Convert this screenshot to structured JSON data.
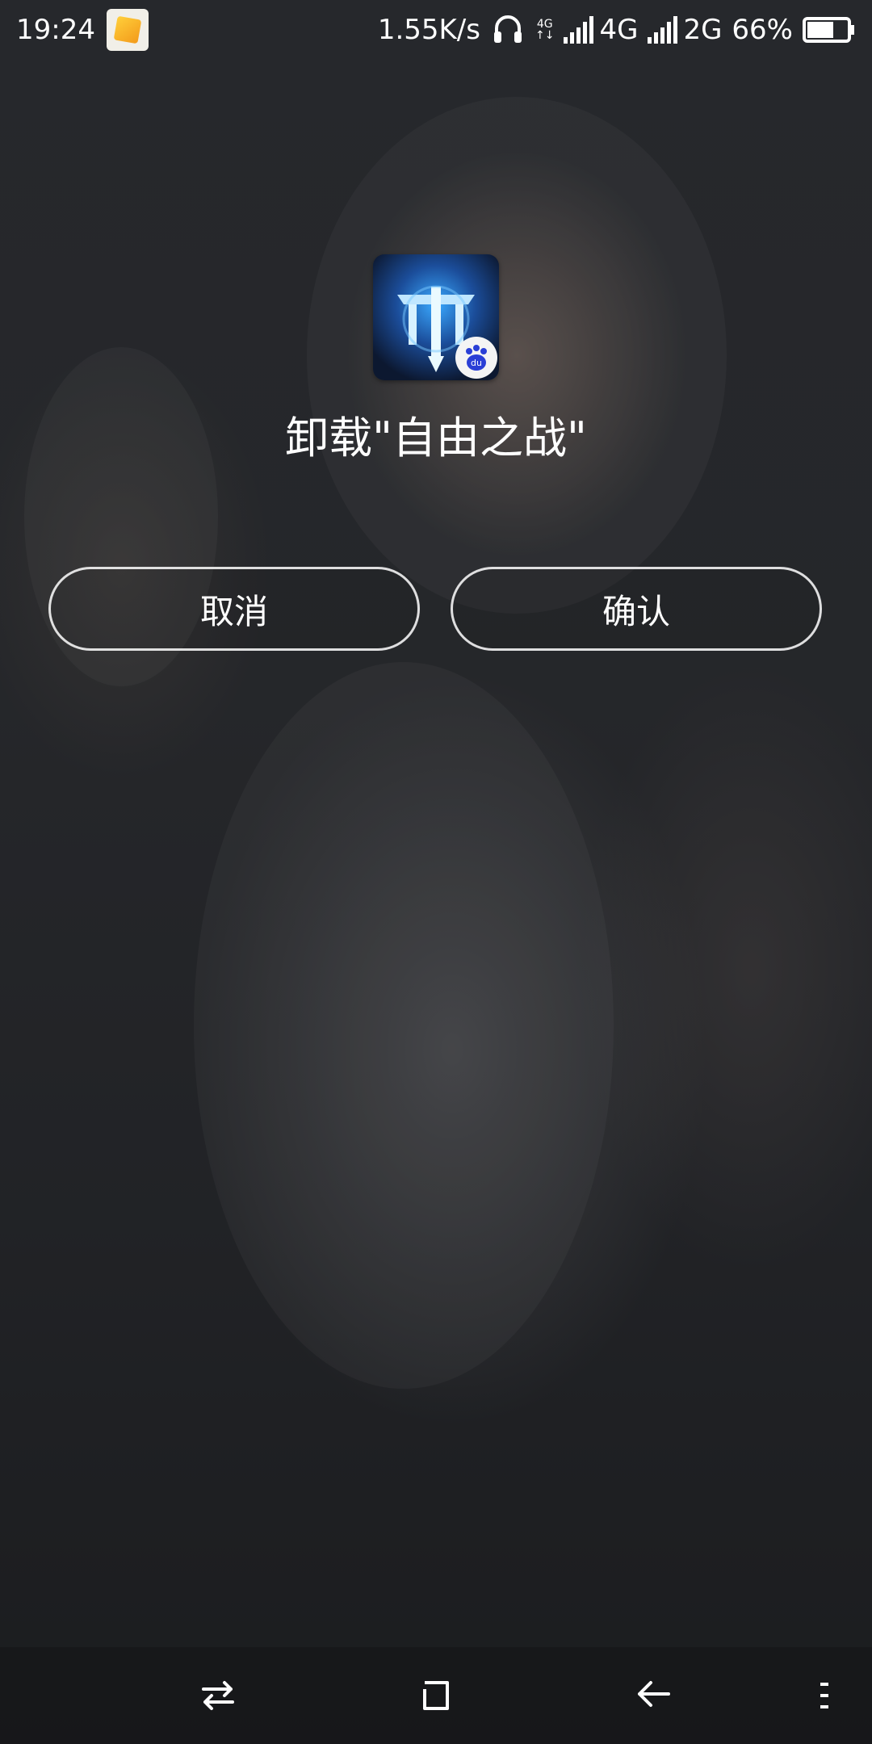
{
  "status_bar": {
    "time": "19:24",
    "speed": "1.55K/s",
    "net_tag": "4G",
    "net_sub": "↑↓",
    "sim1_type": "4G",
    "sim2_type": "2G",
    "battery": "66%",
    "battery_level": 0.66
  },
  "dialog": {
    "title": "卸载\"自由之战\"",
    "cancel_label": "取消",
    "confirm_label": "确认",
    "badge_text": "du"
  },
  "colors": {
    "text": "#ffffff",
    "button_border": "#e6e6e6"
  },
  "nav": {
    "icons": [
      "switch-icon",
      "home-icon",
      "back-icon",
      "menu-icon"
    ]
  }
}
